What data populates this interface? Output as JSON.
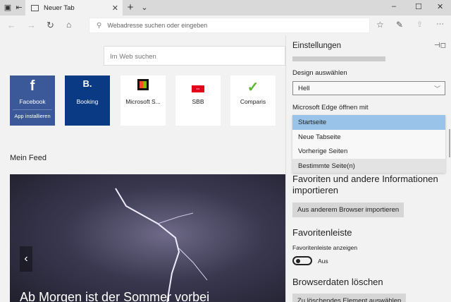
{
  "browser": {
    "tab_title": "Neuer Tab",
    "address_placeholder": "Webadresse suchen oder eingeben",
    "icons": [
      "tab-preview-icon",
      "set-aside-icon",
      "new-tab-icon",
      "tab-list-icon",
      "back-icon",
      "forward-icon",
      "refresh-icon",
      "home-icon",
      "favorites-icon",
      "notes-icon",
      "share-icon",
      "more-icon"
    ]
  },
  "newtab": {
    "web_search_placeholder": "Im Web suchen",
    "tiles": [
      {
        "label": "Facebook",
        "sub": "App installieren",
        "icon": "f",
        "bg": "#3b5998"
      },
      {
        "label": "Booking",
        "icon": "B.",
        "bg": "#0b3a85"
      },
      {
        "label": "Microsoft S...",
        "icon": "store-icon",
        "bg": "#ffffff"
      },
      {
        "label": "SBB",
        "icon": "sbb-icon",
        "bg": "#ffffff"
      },
      {
        "label": "Comparis",
        "icon": "check-icon",
        "bg": "#ffffff"
      }
    ],
    "feed_title": "Mein Feed",
    "headline": "Ab Morgen ist der Sommer vorbei"
  },
  "settings": {
    "title": "Einstellungen",
    "design_label": "Design auswählen",
    "design_value": "Hell",
    "open_with_label": "Microsoft Edge öffnen mit",
    "open_with_options": [
      "Startseite",
      "Neue Tabseite",
      "Vorherige Seiten",
      "Bestimmte Seite(n)"
    ],
    "import_heading": "Favoriten und andere Informationen importieren",
    "import_button": "Aus anderem Browser importieren",
    "favbar_heading": "Favoritenleiste",
    "favbar_label": "Favoritenleiste anzeigen",
    "favbar_toggle": "Aus",
    "clear_heading": "Browserdaten löschen",
    "clear_button": "Zu löschendes Element auswählen"
  }
}
